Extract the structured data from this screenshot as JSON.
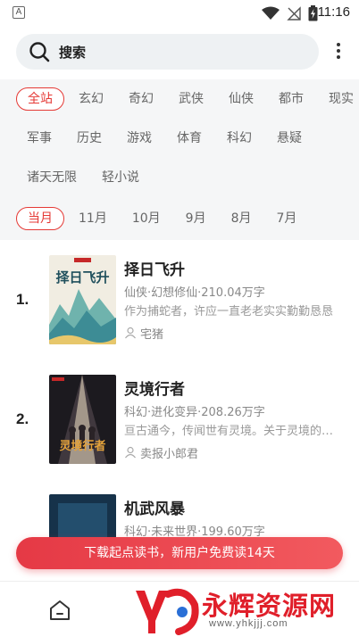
{
  "status_bar": {
    "notification_letter": "A",
    "time": "11:16",
    "icons": [
      "wifi-icon",
      "no-signal-icon",
      "battery-charging-icon"
    ]
  },
  "search": {
    "label": "搜索"
  },
  "categories": {
    "row1": [
      "全站",
      "玄幻",
      "奇幻",
      "武侠",
      "仙侠",
      "都市",
      "现实"
    ],
    "row2": [
      "军事",
      "历史",
      "游戏",
      "体育",
      "科幻",
      "悬疑"
    ],
    "row3": [
      "诸天无限",
      "轻小说"
    ],
    "selected": "全站"
  },
  "months": {
    "items": [
      "当月",
      "11月",
      "10月",
      "9月",
      "8月",
      "7月"
    ],
    "selected": "当月"
  },
  "books": [
    {
      "rank": "1.",
      "title": "择日飞升",
      "meta": "仙侠·幻想修仙·210.04万字",
      "desc": "作为捕蛇者，许应一直老老实实勤勤恳恳",
      "author": "宅猪",
      "cover_text": "择日飞升"
    },
    {
      "rank": "2.",
      "title": "灵境行者",
      "meta": "科幻·进化变异·208.26万字",
      "desc": "亘古通今，传闻世有灵境。关于灵境的传说",
      "author": "卖报小郎君",
      "cover_text": "灵境行者"
    },
    {
      "rank": "",
      "title": "机武风暴",
      "meta": "科幻·未来世界·199.60万字",
      "desc": "",
      "author": "",
      "cover_text": ""
    }
  ],
  "banner": {
    "text": "下载起点读书，新用户免费读14天"
  },
  "watermark": {
    "text": "永辉资源网",
    "url": "www.yhkjjj.com"
  },
  "colors": {
    "accent": "#e53935",
    "panel_bg": "#f5f6f7",
    "search_bg": "#eef1f3"
  }
}
